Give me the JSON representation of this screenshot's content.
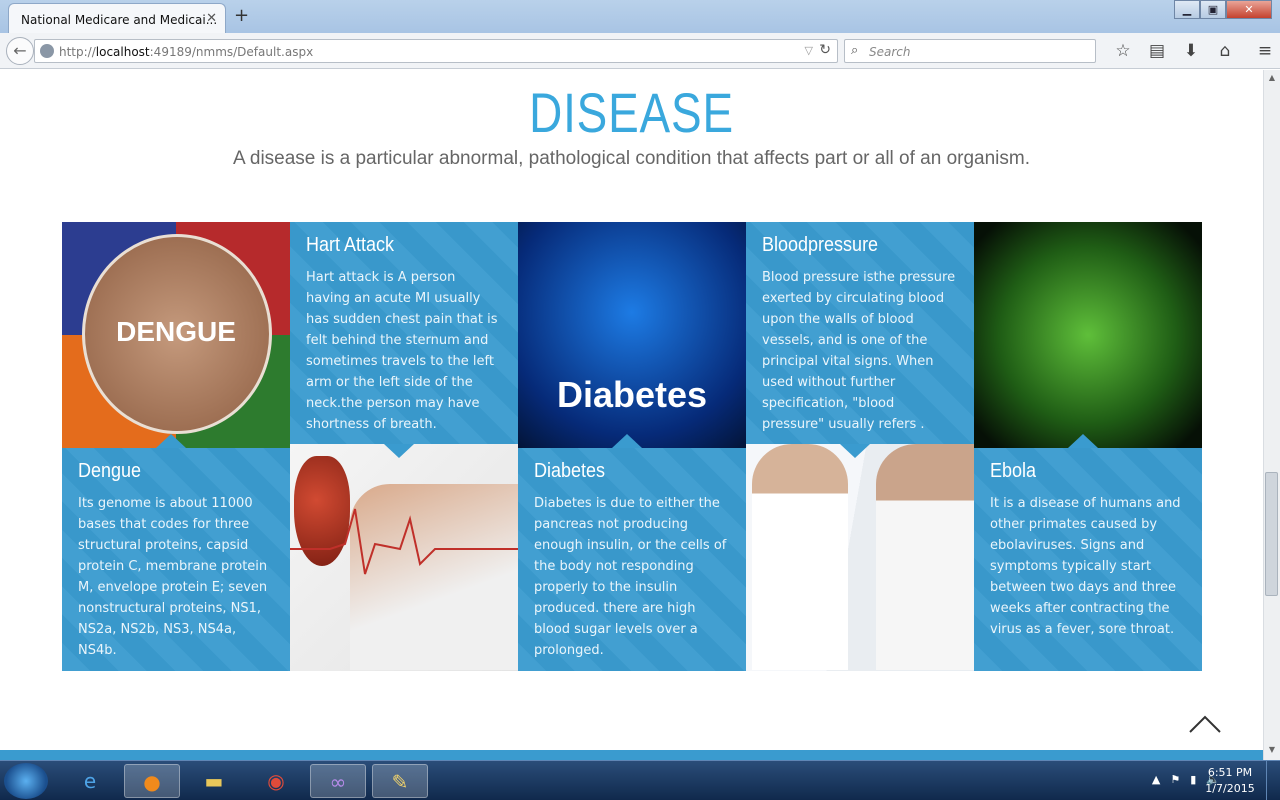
{
  "browser": {
    "tab_title": "National Medicare and Medicai...",
    "tab_close": "✕",
    "new_tab": "+",
    "url_prefix": "http://",
    "url_host": "localhost",
    "url_rest": ":49189/nmms/Default.aspx",
    "search_placeholder": "Search",
    "window_buttons": [
      "▁",
      "▣",
      "✕"
    ]
  },
  "page": {
    "heading": "DISEASE",
    "subheading": "A disease is a particular abnormal, pathological condition that affects part or all of an organism."
  },
  "diseases": [
    {
      "title": "Hart Attack",
      "desc": "Hart attack is A person having an acute MI usually has sudden chest pain that is felt behind the sternum and sometimes travels to the left arm or the left side of the neck.the person may have shortness of breath."
    },
    {
      "title": "Bloodpressure",
      "desc": "Blood pressure isthe pressure exerted by circulating blood upon the walls of blood vessels, and is one of the principal vital signs. When used without further specification, \"blood pressure\" usually refers ."
    },
    {
      "title": "Dengue",
      "desc": "Its genome is about 11000 bases that codes for three structural proteins, capsid protein C, membrane protein M, envelope protein E; seven nonstructural proteins, NS1, NS2a, NS2b, NS3, NS4a, NS4b."
    },
    {
      "title": "Diabetes",
      "desc": "Diabetes is due to either the pancreas not producing enough insulin, or the cells of the body not responding properly to the insulin produced. there are high blood sugar levels over a prolonged."
    },
    {
      "title": "Ebola",
      "desc": "It is a disease of humans and other primates caused by ebolaviruses. Signs and symptoms typically start between two days and three weeks after contracting the virus as a fever, sore throat."
    }
  ],
  "images": {
    "dengue_label": "DENGUE",
    "diabetes_label": "Diabetes"
  },
  "taskbar": {
    "time": "6:51 PM",
    "date": "1/7/2015",
    "apps": [
      "internet-explorer-icon",
      "firefox-icon",
      "file-explorer-icon",
      "chrome-icon",
      "visual-studio-icon",
      "paint-icon"
    ]
  },
  "colors": {
    "accent": "#3aa8dd",
    "card": "#3a9bcf"
  }
}
